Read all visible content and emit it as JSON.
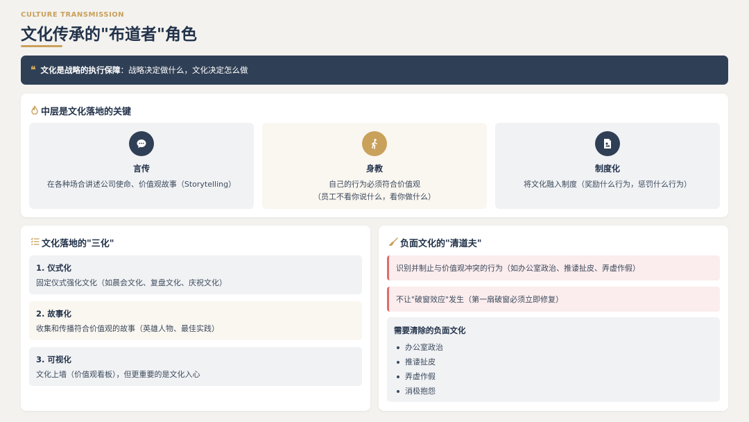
{
  "header": {
    "kicker": "CULTURE TRANSMISSION",
    "title": "文化传承的\"布道者\"角色"
  },
  "quote": {
    "icon": "quote-icon",
    "strong": "文化是战略的执行保障",
    "rest": "：战略决定做什么，文化决定怎么做"
  },
  "middle": {
    "title": "中层是文化落地的关键",
    "icon": "fire-icon",
    "roles": [
      {
        "icon": "speech-bubble-icon",
        "title": "言传",
        "desc1": "在各种场合讲述公司使命、价值观故事（Storytelling）",
        "desc2": "",
        "color": "#2f3f55",
        "bg": "#f1f2f4"
      },
      {
        "icon": "walking-person-icon",
        "title": "身教",
        "desc1": "自己的行为必须符合价值观",
        "desc2": "（员工不看你说什么，看你做什么）",
        "color": "#c9a15a",
        "bg": "#faf6f0"
      },
      {
        "icon": "document-icon",
        "title": "制度化",
        "desc1": "将文化融入制度（奖励什么行为，惩罚什么行为）",
        "desc2": "",
        "color": "#2f3f55",
        "bg": "#f1f2f4"
      }
    ]
  },
  "three": {
    "title": "文化落地的\"三化\"",
    "icon": "list-icon",
    "items": [
      {
        "title": "1. 仪式化",
        "desc": "固定仪式强化文化（如晨会文化、复盘文化、庆祝文化）",
        "bg": "#f1f2f4"
      },
      {
        "title": "2. 故事化",
        "desc": "收集和传播符合价值观的故事（英雄人物、最佳实践）",
        "bg": "#faf6f0"
      },
      {
        "title": "3. 可视化",
        "desc": "文化上墙（价值观看板），但更重要的是文化入心",
        "bg": "#f1f2f4"
      }
    ]
  },
  "cleaner": {
    "title": "负面文化的\"清道夫\"",
    "icon": "broom-icon",
    "warnings": [
      "识别并制止与价值观冲突的行为（如办公室政治、推诿扯皮、弄虚作假）",
      "不让\"破窗效应\"发生（第一扇破窗必须立即修复）"
    ],
    "list_title": "需要清除的负面文化",
    "list": [
      "办公室政治",
      "推诿扯皮",
      "弄虚作假",
      "消极抱怨"
    ]
  },
  "colors": {
    "accent": "#c9a15a",
    "navy": "#2f3f55",
    "warn": "#e06b6b"
  }
}
